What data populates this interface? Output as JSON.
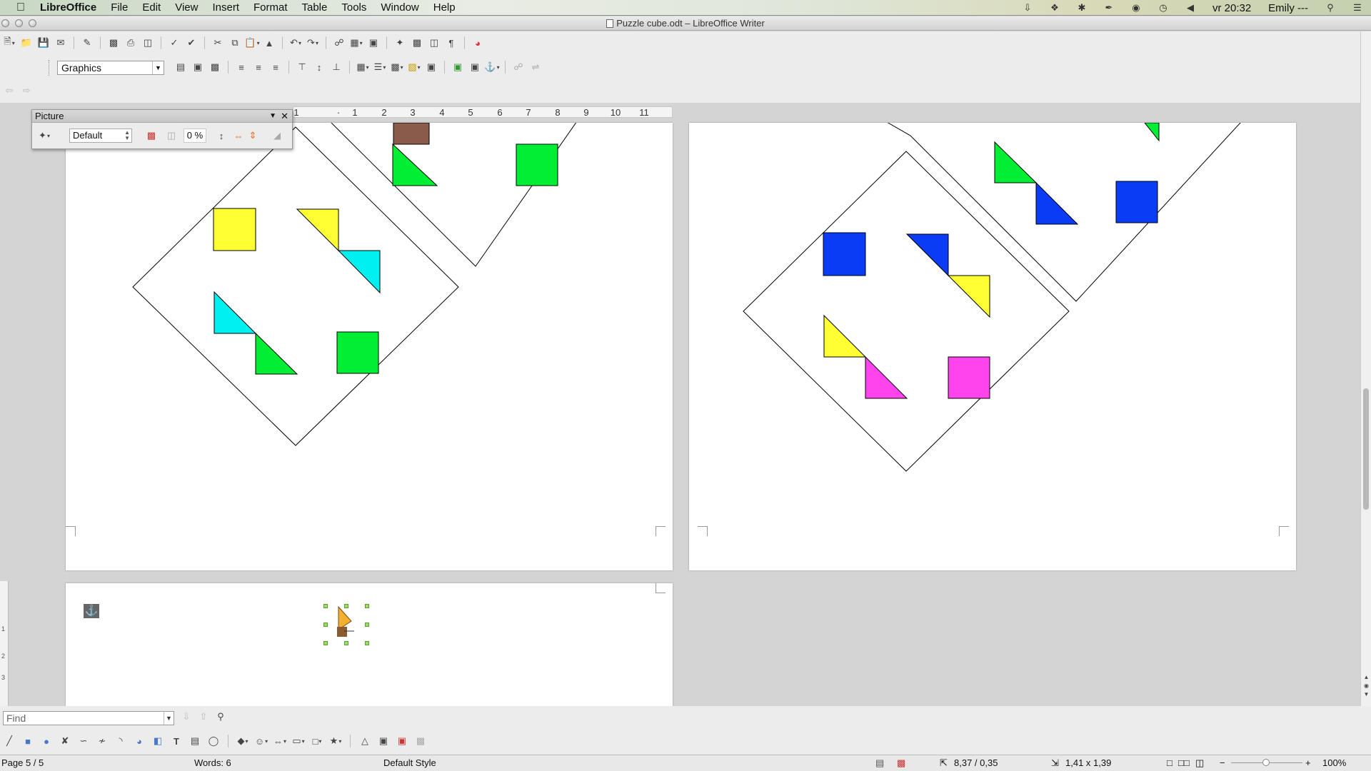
{
  "menubar": {
    "app_name": "LibreOffice",
    "items": [
      "File",
      "Edit",
      "View",
      "Insert",
      "Format",
      "Table",
      "Tools",
      "Window",
      "Help"
    ],
    "clock": "vr 20:32",
    "user": "Emily ---"
  },
  "window": {
    "title": "Puzzle cube.odt – LibreOffice Writer"
  },
  "formatting_toolbar": {
    "style_value": "Graphics"
  },
  "ruler": {
    "ticks": [
      "1",
      "·",
      "1",
      "2",
      "3",
      "4",
      "5",
      "6",
      "7",
      "8",
      "9",
      "10",
      "11"
    ]
  },
  "picture_toolbar": {
    "title": "Picture",
    "graphics_mode": "Default",
    "transparency": "0 %"
  },
  "find": {
    "placeholder": "Find"
  },
  "statusbar": {
    "page": "Page 5 / 5",
    "words": "Words: 6",
    "page_style": "Default Style",
    "position": "8,37 / 0,35",
    "size": "1,41 x 1,39",
    "zoom": "100%"
  },
  "colors": {
    "green": "#00ee33",
    "yellow": "#ffff33",
    "cyan": "#00f0f0",
    "blue": "#0a3bf5",
    "magenta": "#ff44ee",
    "brown": "#8a5a4a"
  }
}
